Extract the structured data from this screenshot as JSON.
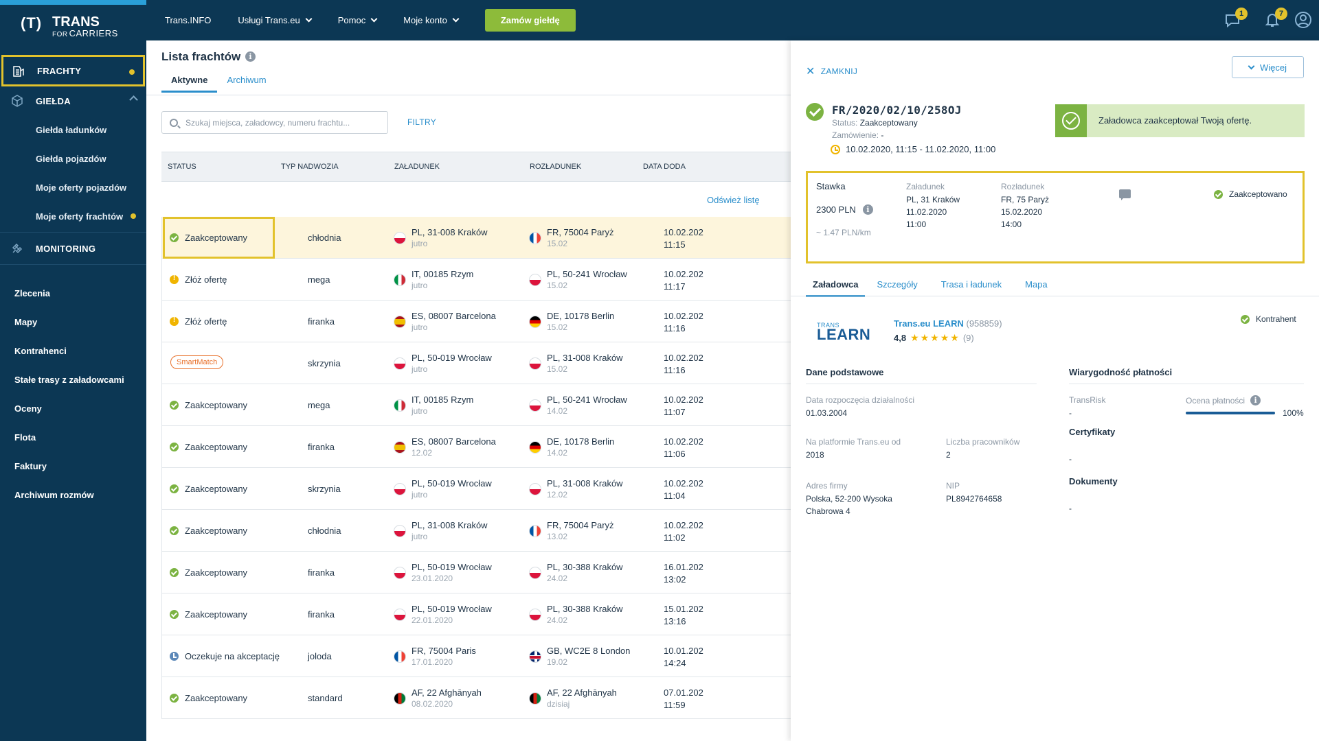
{
  "brand": {
    "mark": "(T)",
    "name": "TRANS",
    "for": "FOR",
    "carriers": "CARRIERS"
  },
  "sidebar": {
    "items": [
      {
        "label": "FRACHTY",
        "icon": "freight-icon",
        "active": true,
        "dot": true
      },
      {
        "label": "GIEŁDA",
        "icon": "box-icon",
        "expanded": true
      }
    ],
    "sub_items": [
      {
        "label": "Giełda ładunków"
      },
      {
        "label": "Giełda pojazdów"
      },
      {
        "label": "Moje oferty pojazdów"
      },
      {
        "label": "Moje oferty frachtów",
        "dot": true
      }
    ],
    "monitoring": {
      "label": "MONITORING",
      "icon": "satellite-icon"
    },
    "plain_items": [
      "Zlecenia",
      "Mapy",
      "Kontrahenci",
      "Stałe trasy z załadowcami",
      "Oceny",
      "Flota",
      "Faktury",
      "Archiwum rozmów"
    ]
  },
  "topnav": {
    "items": [
      {
        "label": "Trans.INFO",
        "dropdown": false
      },
      {
        "label": "Usługi Trans.eu",
        "dropdown": true
      },
      {
        "label": "Pomoc",
        "dropdown": true
      },
      {
        "label": "Moje konto",
        "dropdown": true
      }
    ],
    "cta": "Zamów giełdę",
    "messages_badge": "1",
    "notifications_badge": "7"
  },
  "list": {
    "title": "Lista frachtów",
    "tabs": [
      "Aktywne",
      "Archiwum"
    ],
    "search_placeholder": "Szukaj miejsca, załadowcy, numeru frachtu...",
    "filters": "FILTRY",
    "refresh": "Odśwież listę",
    "columns": [
      "STATUS",
      "TYP NADWOZIA",
      "ZAŁADUNEK",
      "ROZŁADUNEK",
      "DATA DODA"
    ],
    "rows": [
      {
        "status": "Zaakceptowany",
        "st": "ok",
        "body": "chłodnia",
        "from_flag": "pl",
        "from": "PL, 31-008 Kraków",
        "from_date": "jutro",
        "to_flag": "fr",
        "to": "FR, 75004 Paryż",
        "to_date": "15.02",
        "date": "10.02.202",
        "time": "11:15",
        "selected": true
      },
      {
        "status": "Złóż ofertę",
        "st": "warn",
        "body": "mega",
        "from_flag": "it",
        "from": "IT, 00185 Rzym",
        "from_date": "jutro",
        "to_flag": "pl",
        "to": "PL, 50-241 Wrocław",
        "to_date": "15.02",
        "date": "10.02.202",
        "time": "11:17"
      },
      {
        "status": "Złóż ofertę",
        "st": "warn",
        "body": "firanka",
        "from_flag": "es",
        "from": "ES, 08007 Barcelona",
        "from_date": "jutro",
        "to_flag": "de",
        "to": "DE, 10178 Berlin",
        "to_date": "15.02",
        "date": "10.02.202",
        "time": "11:16"
      },
      {
        "status": "SmartMatch",
        "st": "smart",
        "body": "skrzynia",
        "from_flag": "pl",
        "from": "PL, 50-019 Wrocław",
        "from_date": "jutro",
        "to_flag": "pl",
        "to": "PL, 31-008 Kraków",
        "to_date": "15.02",
        "date": "10.02.202",
        "time": "11:16"
      },
      {
        "status": "Zaakceptowany",
        "st": "ok",
        "body": "mega",
        "from_flag": "it",
        "from": "IT, 00185 Rzym",
        "from_date": "jutro",
        "to_flag": "pl",
        "to": "PL, 50-241 Wrocław",
        "to_date": "14.02",
        "date": "10.02.202",
        "time": "11:07"
      },
      {
        "status": "Zaakceptowany",
        "st": "ok",
        "body": "firanka",
        "from_flag": "es",
        "from": "ES, 08007 Barcelona",
        "from_date": "12.02",
        "to_flag": "de",
        "to": "DE, 10178 Berlin",
        "to_date": "14.02",
        "date": "10.02.202",
        "time": "11:06"
      },
      {
        "status": "Zaakceptowany",
        "st": "ok",
        "body": "skrzynia",
        "from_flag": "pl",
        "from": "PL, 50-019 Wrocław",
        "from_date": "jutro",
        "to_flag": "pl",
        "to": "PL, 31-008 Kraków",
        "to_date": "12.02",
        "date": "10.02.202",
        "time": "11:04"
      },
      {
        "status": "Zaakceptowany",
        "st": "ok",
        "body": "chłodnia",
        "from_flag": "pl",
        "from": "PL, 31-008 Kraków",
        "from_date": "jutro",
        "to_flag": "fr",
        "to": "FR, 75004 Paryż",
        "to_date": "13.02",
        "date": "10.02.202",
        "time": "11:02"
      },
      {
        "status": "Zaakceptowany",
        "st": "ok",
        "body": "firanka",
        "from_flag": "pl",
        "from": "PL, 50-019 Wrocław",
        "from_date": "23.01.2020",
        "to_flag": "pl",
        "to": "PL, 30-388 Kraków",
        "to_date": "24.02",
        "date": "16.01.202",
        "time": "13:02"
      },
      {
        "status": "Zaakceptowany",
        "st": "ok",
        "body": "firanka",
        "from_flag": "pl",
        "from": "PL, 50-019 Wrocław",
        "from_date": "22.01.2020",
        "to_flag": "pl",
        "to": "PL, 30-388 Kraków",
        "to_date": "24.02",
        "date": "15.01.202",
        "time": "13:16"
      },
      {
        "status": "Oczekuje na akceptację",
        "st": "wait",
        "body": "joloda",
        "from_flag": "fr",
        "from": "FR, 75004 Paris",
        "from_date": "17.01.2020",
        "to_flag": "gb",
        "to": "GB, WC2E 8 London",
        "to_date": "19.02",
        "date": "10.01.202",
        "time": "14:24"
      },
      {
        "status": "Zaakceptowany",
        "st": "ok",
        "body": "standard",
        "from_flag": "af",
        "from": "AF, 22 Afghānyah",
        "from_date": "08.02.2020",
        "to_flag": "af",
        "to": "AF, 22 Afghānyah",
        "to_date": "dzisiaj",
        "date": "07.01.202",
        "time": "11:59"
      }
    ]
  },
  "detail": {
    "close": "ZAMKNIJ",
    "more": "Więcej",
    "number": "FR/2020/02/10/258OJ",
    "status_label": "Status:",
    "status_value": "Zaakceptowany",
    "order_label": "Zamówienie:",
    "order_value": "-",
    "time_range": "10.02.2020, 11:15 - 11.02.2020, 11:00",
    "alert": "Załadowca zaakceptował Twoją ofertę.",
    "offer": {
      "stawka_label": "Stawka",
      "price": "2300  PLN",
      "per_km": "~ 1.47 PLN/km",
      "load_label": "Załadunek",
      "load_place": "PL, 31 Kraków",
      "load_date": "11.02.2020",
      "load_time": "11:00",
      "unload_label": "Rozładunek",
      "unload_place": "FR, 75 Paryż",
      "unload_date": "15.02.2020",
      "unload_time": "14:00",
      "status": "Zaakceptowano"
    },
    "tabs": [
      "Załadowca",
      "Szczegóły",
      "Trasa i ładunek",
      "Mapa"
    ],
    "company": {
      "logo_top": "TRANS",
      "logo_main": "LEARN",
      "name": "Trans.eu LEARN",
      "id": "(958859)",
      "rating": "4,8",
      "stars": "★★★★★",
      "reviews": "(9)",
      "kontrahent": "Kontrahent"
    },
    "basic": {
      "title": "Dane podstawowe",
      "start_label": "Data rozpoczęcia działalności",
      "start_value": "01.03.2004",
      "platform_label": "Na platformie Trans.eu od",
      "platform_value": "2018",
      "employees_label": "Liczba pracowników",
      "employees_value": "2",
      "address_label": "Adres firmy",
      "address_line1": "Polska, 52-200 Wysoka",
      "address_line2": "Chabrowa 4",
      "nip_label": "NIP",
      "nip_value": "PL8942764658"
    },
    "payment": {
      "title": "Wiarygodność płatności",
      "transrisk_label": "TransRisk",
      "transrisk_value": "-",
      "score_label": "Ocena płatności",
      "score_value": "100%",
      "score_fraction": 1.0,
      "certs_title": "Certyfikaty",
      "certs_value": "-",
      "docs_title": "Dokumenty",
      "docs_value": "-"
    }
  }
}
